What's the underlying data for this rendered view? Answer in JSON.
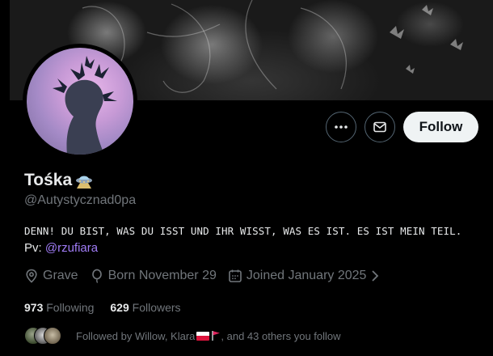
{
  "profile": {
    "display_name": "Tośka",
    "name_emoji": "ufo-icon",
    "username": "@Autystycznad0pa",
    "bio_line1": "DENN! DU BIST, WAS DU ISST UND IHR WISST, WAS ES IST. ES IST MEIN TEIL.",
    "bio_pv_label": "Pv:",
    "bio_pv_link": "@rzufiara",
    "location": "Grave",
    "born": "Born November 29",
    "joined": "Joined January 2025"
  },
  "actions": {
    "more_icon": "ellipsis-icon",
    "message_icon": "envelope-icon",
    "follow_label": "Follow"
  },
  "stats": {
    "following_count": "973",
    "following_label": "Following",
    "followers_count": "629",
    "followers_label": "Followers"
  },
  "followed_by": {
    "prefix": "Followed by Willow, Klara",
    "suffix": ", and 43 others you follow",
    "flags": [
      "poland-flag-icon",
      "red-flag-icon"
    ]
  },
  "colors": {
    "background": "#000000",
    "text_primary": "#e7e9ea",
    "text_secondary": "#71767b",
    "link": "#a07cf6",
    "follow_button_bg": "#eff3f4",
    "button_border": "#536471"
  }
}
